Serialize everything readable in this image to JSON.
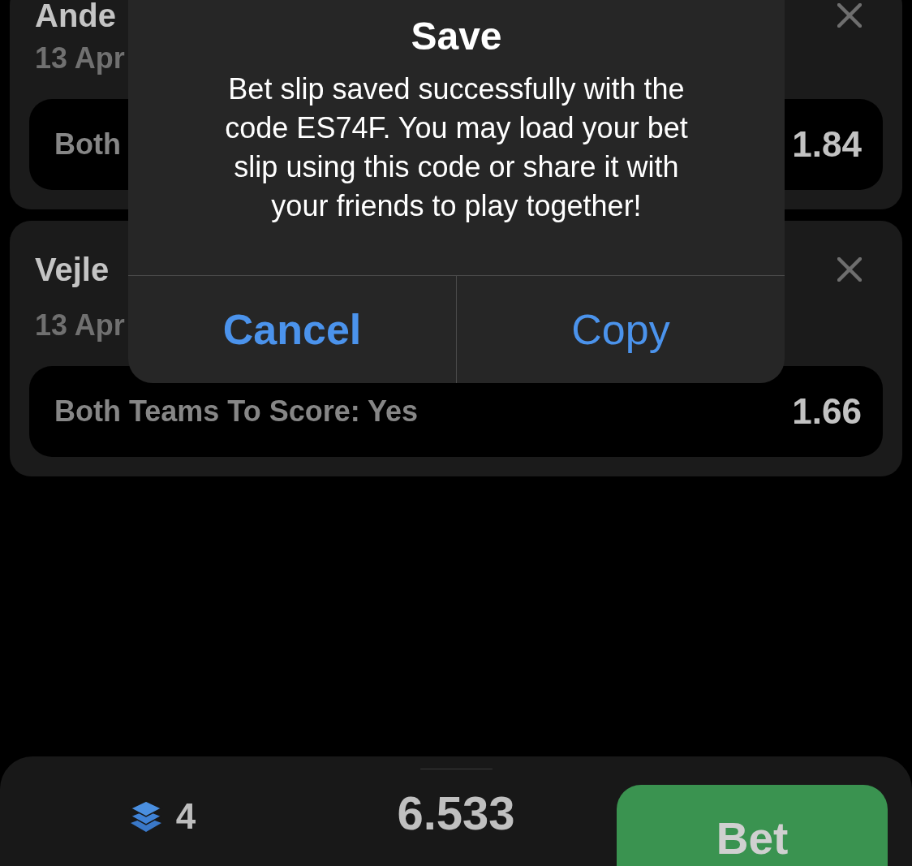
{
  "selections": [
    {
      "match": "Ande",
      "date": "13 Apr",
      "market": "Both",
      "odds": "1.84"
    },
    {
      "match": "Vejle",
      "date": "13 Apr",
      "market": "Both Teams To Score: Yes",
      "odds": "1.66"
    }
  ],
  "alert": {
    "title": "Save",
    "message": "Bet slip saved successfully with the code ES74F. You may load your bet slip using this code or share it with your friends to play together!",
    "buttons": [
      {
        "label": "Cancel",
        "kind": "cancel"
      },
      {
        "label": "Copy",
        "kind": "copy"
      }
    ]
  },
  "summary": {
    "events": "4",
    "total_odds": "6.533",
    "bet_button": "Bet"
  }
}
